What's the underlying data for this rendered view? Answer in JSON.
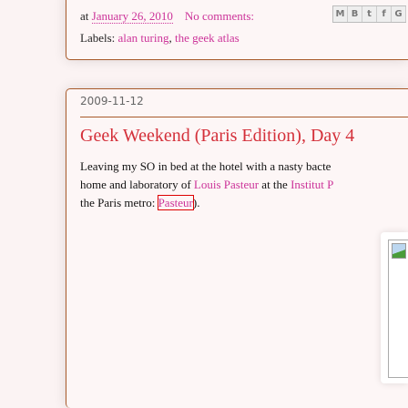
{
  "previous_post": {
    "posted_at_prefix": "at",
    "date_link": "January 26, 2010",
    "comments_link": "No comments:",
    "share_buttons": [
      "M",
      "B",
      "t",
      "f",
      "G"
    ],
    "labels_prefix": "Labels:",
    "labels": [
      "alan turing",
      "the geek atlas"
    ],
    "labels_separator": ", "
  },
  "post": {
    "date": "2009-11-12",
    "title": "Geek Weekend (Paris Edition), Day 4",
    "body": {
      "line1": "Leaving my SO in bed at the hotel with a nasty bacte",
      "line2_a": "home and laboratory of ",
      "link_louis_pasteur": "Louis Pasteur",
      "line2_b": " at the ",
      "link_institut": "Institut P",
      "line3_a": "the Paris metro: ",
      "link_metro": "Pasteur",
      "line3_b": ")."
    }
  }
}
